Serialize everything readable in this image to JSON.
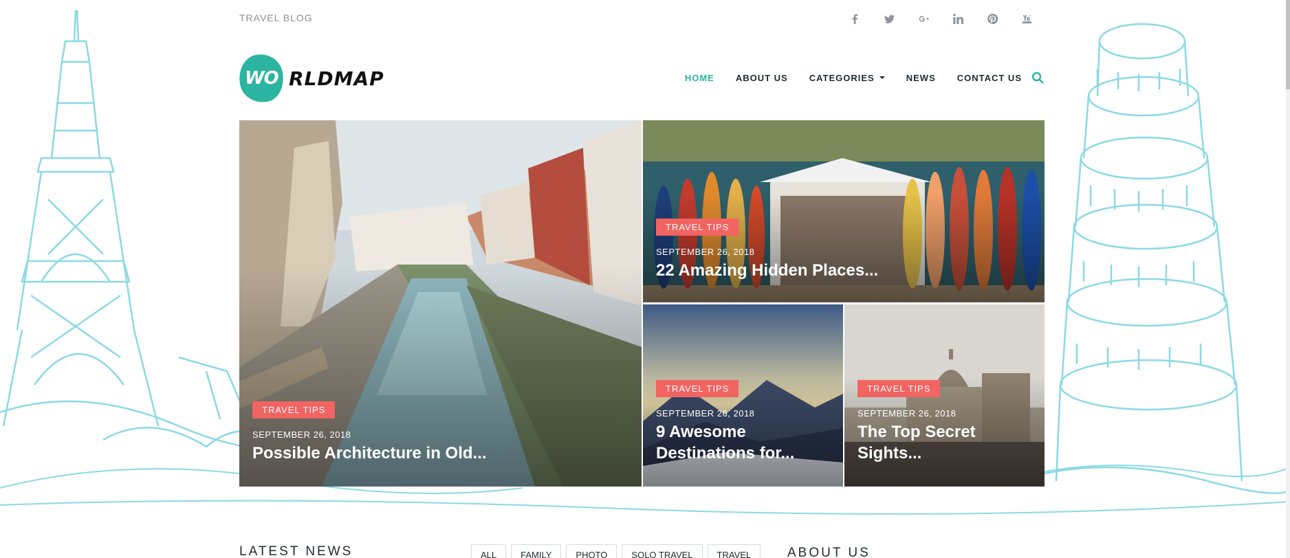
{
  "topbar": {
    "label": "TRAVEL BLOG",
    "social": [
      {
        "icon": "facebook-icon"
      },
      {
        "icon": "twitter-icon"
      },
      {
        "icon": "google-plus-icon"
      },
      {
        "icon": "linkedin-icon"
      },
      {
        "icon": "pinterest-icon"
      },
      {
        "icon": "youtube-icon"
      }
    ]
  },
  "logo": {
    "mark": "WO",
    "text": "RLDMAP"
  },
  "nav": {
    "items": [
      {
        "label": "HOME",
        "active": true
      },
      {
        "label": "ABOUT US",
        "active": false
      },
      {
        "label": "CATEGORIES",
        "active": false,
        "dropdown": true
      },
      {
        "label": "NEWS",
        "active": false
      },
      {
        "label": "CONTACT US",
        "active": false
      }
    ],
    "search_icon": "search-icon"
  },
  "hero": {
    "cards": [
      {
        "tag": "TRAVEL TIPS",
        "date": "SEPTEMBER 26, 2018",
        "title": "Possible Architecture in Old..."
      },
      {
        "tag": "TRAVEL TIPS",
        "date": "SEPTEMBER 26, 2018",
        "title": "22 Amazing Hidden Places..."
      },
      {
        "tag": "TRAVEL TIPS",
        "date": "SEPTEMBER 26, 2018",
        "title": "9 Awesome Destinations for..."
      },
      {
        "tag": "TRAVEL TIPS",
        "date": "SEPTEMBER 26, 2018",
        "title": "The Top Secret Sights..."
      }
    ]
  },
  "latest_news": {
    "heading": "LATEST NEWS",
    "filters": [
      "ALL",
      "FAMILY",
      "PHOTO",
      "SOLO TRAVEL",
      "TRAVEL"
    ]
  },
  "about": {
    "heading": "ABOUT US"
  },
  "colors": {
    "accent": "#2cb5a0",
    "tag": "#f26462",
    "sketch": "#8ad9e5"
  }
}
